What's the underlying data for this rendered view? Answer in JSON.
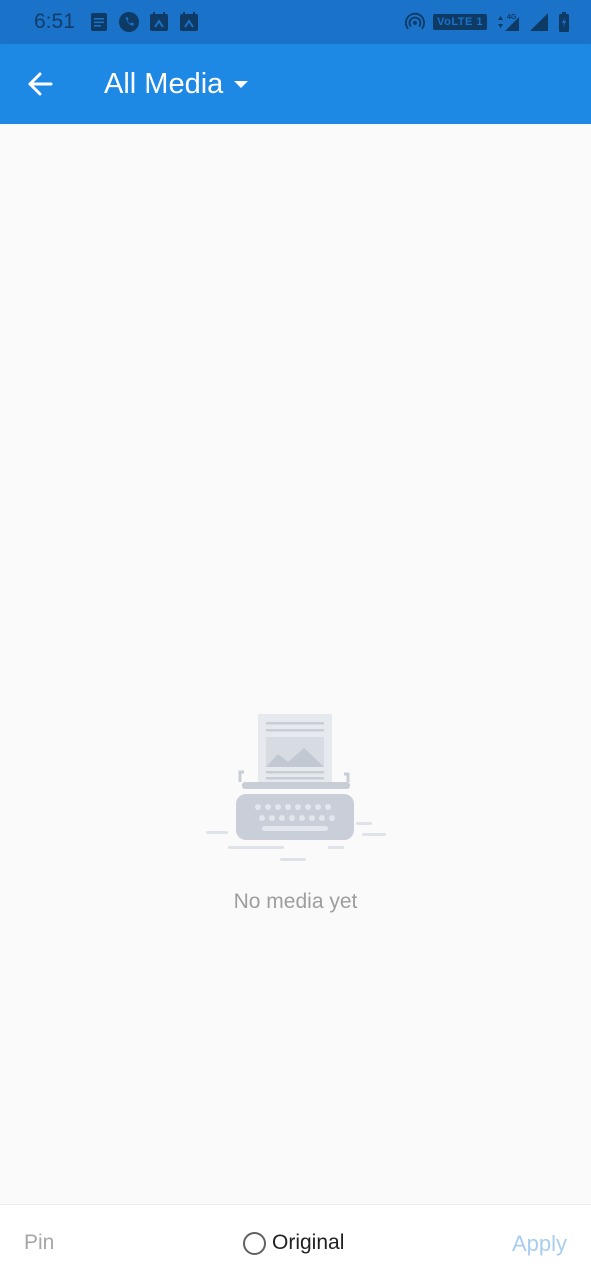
{
  "status_bar": {
    "time": "6:51",
    "left_icons": [
      "docs-icon",
      "phone-icon",
      "calendar-icon",
      "calendar-icon"
    ],
    "volte_label": "VoLTE 1",
    "network_label": "4G",
    "right_icons": [
      "hotspot-icon",
      "data-arrows-icon",
      "signal-icon",
      "signal-icon",
      "battery-icon"
    ]
  },
  "app_bar": {
    "back_icon": "arrow-left-icon",
    "title": "All Media",
    "dropdown_icon": "caret-down-icon",
    "background_color": "#1e88e5"
  },
  "empty_state": {
    "illustration": "typewriter-illustration",
    "message": "No media yet"
  },
  "bottom_bar": {
    "pin_label": "Pin",
    "original_label": "Original",
    "original_checked": false,
    "apply_label": "Apply",
    "apply_color": "#a9cdf0"
  }
}
